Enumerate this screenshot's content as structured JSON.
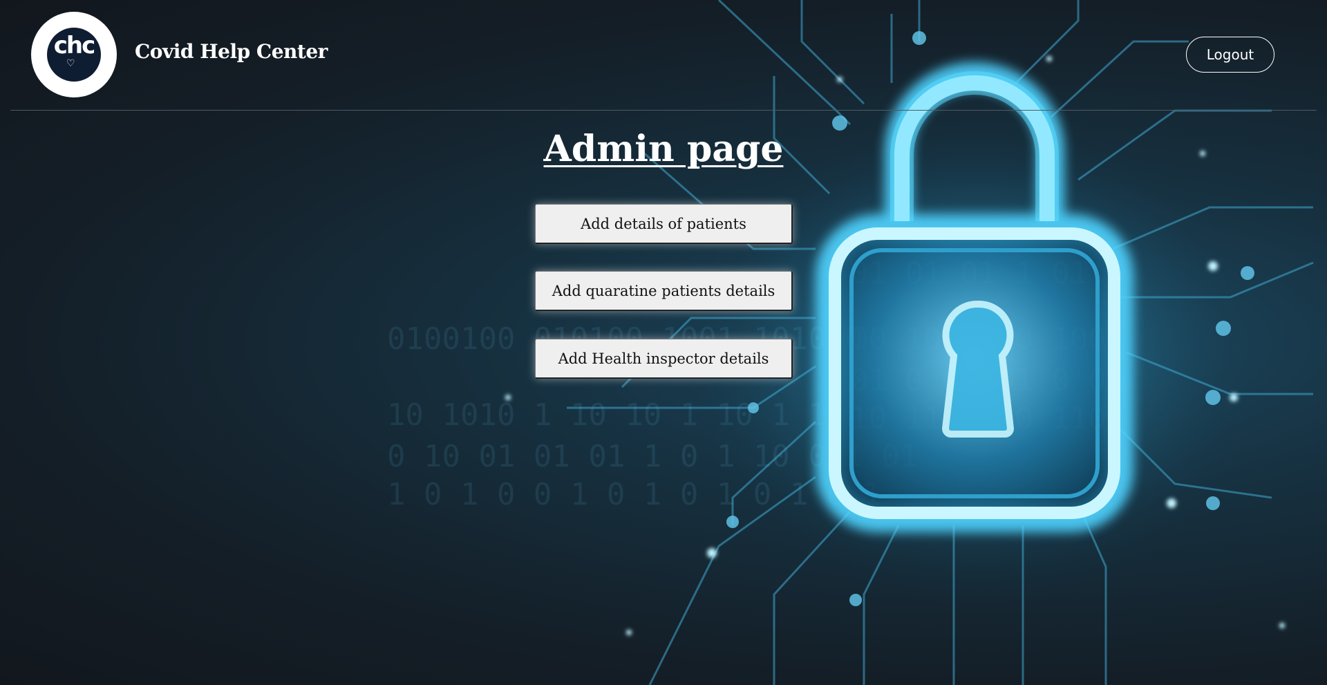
{
  "header": {
    "logo_text": "chc",
    "brand_title": "Covid Help Center",
    "logout_label": "Logout"
  },
  "main": {
    "title": "Admin page",
    "buttons": [
      {
        "label": "Add details of patients"
      },
      {
        "label": "Add quaratine patients details"
      },
      {
        "label": "Add Health inspector details"
      }
    ]
  },
  "icons": {
    "logo": "chc-logo-icon",
    "background": "padlock-icon"
  },
  "colors": {
    "background_dark": "#141e27",
    "glow": "#4fd3ff",
    "button_bg": "#efefef",
    "text_light": "#ffffff"
  }
}
